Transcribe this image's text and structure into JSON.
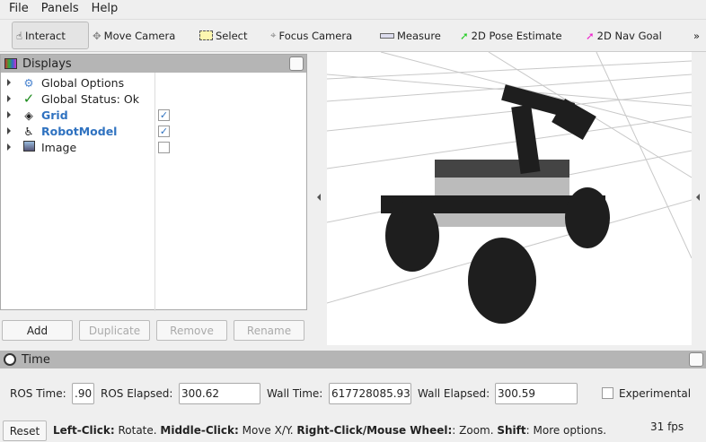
{
  "menu": [
    "File",
    "Panels",
    "Help"
  ],
  "toolbar": {
    "tools": [
      {
        "label": "Interact",
        "icon": "hand-icon"
      },
      {
        "label": "Move Camera",
        "icon": "move-camera-icon"
      },
      {
        "label": "Select",
        "icon": "select-icon"
      },
      {
        "label": "Focus Camera",
        "icon": "focus-camera-icon"
      },
      {
        "label": "Measure",
        "icon": "ruler-icon"
      },
      {
        "label": "2D Pose Estimate",
        "icon": "green-arrow-icon"
      },
      {
        "label": "2D Nav Goal",
        "icon": "magenta-arrow-icon"
      }
    ],
    "more": "»"
  },
  "displays": {
    "title": "Displays",
    "items": [
      {
        "label": "Global Options",
        "icon": "gear-icon"
      },
      {
        "label": "Global Status: Ok",
        "icon": "checkmark-icon"
      },
      {
        "label": "Grid",
        "icon": "grid-icon",
        "checked": true
      },
      {
        "label": "RobotModel",
        "icon": "robot-icon",
        "checked": true
      },
      {
        "label": "Image",
        "icon": "image-icon",
        "checked": false
      }
    ],
    "buttons": {
      "add": "Add",
      "duplicate": "Duplicate",
      "remove": "Remove",
      "rename": "Rename"
    }
  },
  "time": {
    "title": "Time",
    "ros_time_label": "ROS Time:",
    "ros_time": ".90",
    "ros_elapsed_label": "ROS Elapsed:",
    "ros_elapsed": "300.62",
    "wall_time_label": "Wall Time:",
    "wall_time": "617728085.93",
    "wall_elapsed_label": "Wall Elapsed:",
    "wall_elapsed": "300.59",
    "experimental": "Experimental"
  },
  "status": {
    "reset": "Reset",
    "b1": "Left-Click:",
    "t1": " Rotate. ",
    "b2": "Middle-Click:",
    "t2": " Move X/Y. ",
    "b3": "Right-Click/Mouse Wheel:",
    "t3": ": Zoom. ",
    "b4": "Shift",
    "t4": ": More options.",
    "fps": "31 fps"
  }
}
